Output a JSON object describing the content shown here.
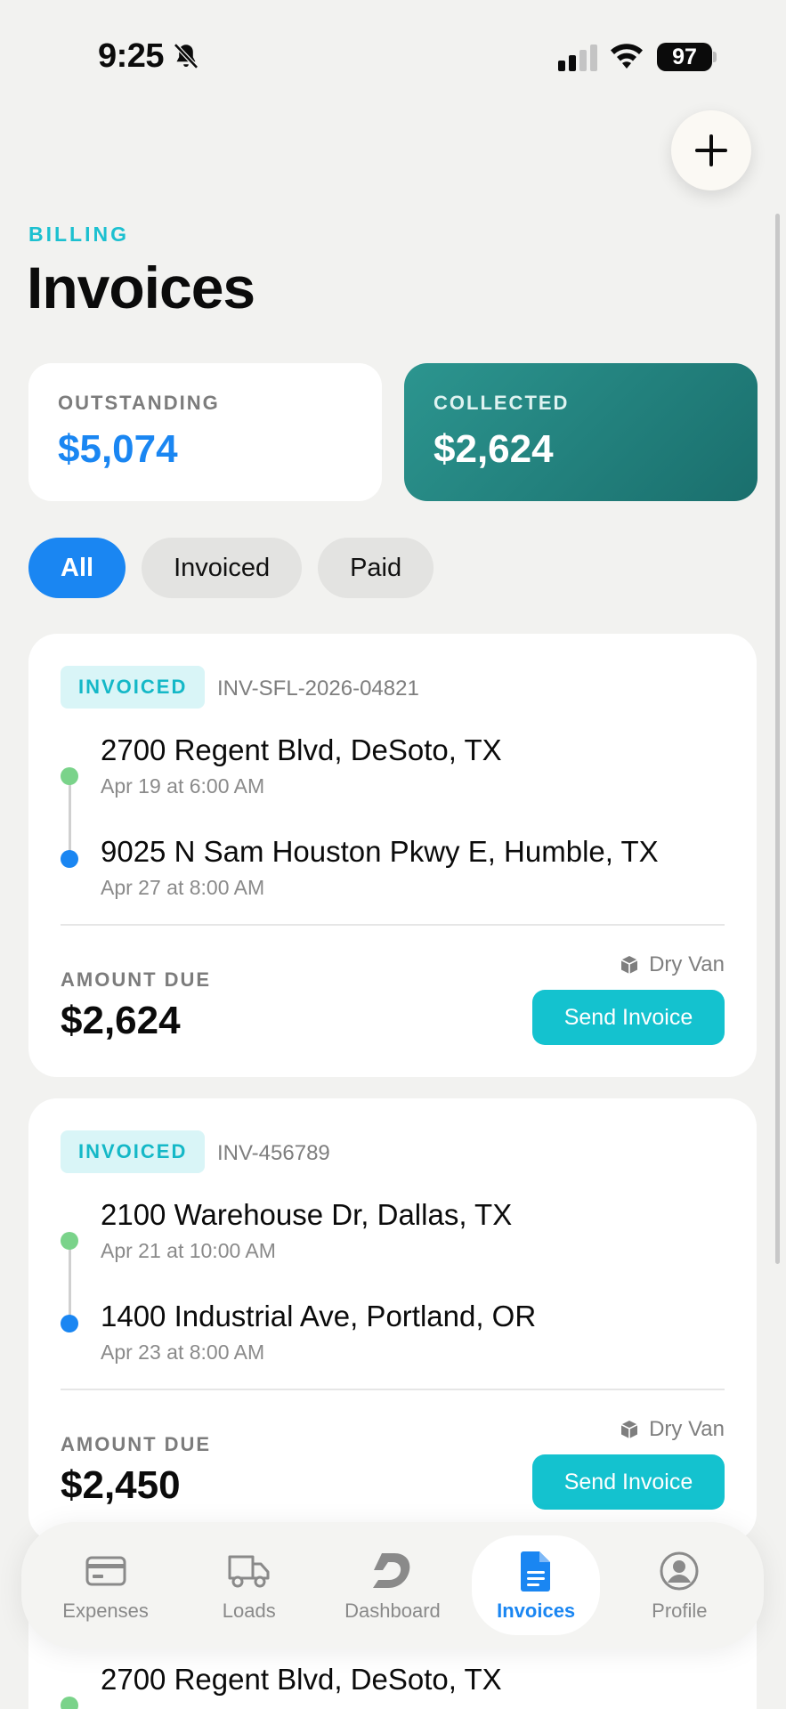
{
  "status_bar": {
    "time": "9:25",
    "battery": "97"
  },
  "header": {
    "eyebrow": "BILLING",
    "title": "Invoices"
  },
  "stats": {
    "outstanding": {
      "label": "OUTSTANDING",
      "value": "$5,074"
    },
    "collected": {
      "label": "COLLECTED",
      "value": "$2,624"
    }
  },
  "filters": [
    "All",
    "Invoiced",
    "Paid"
  ],
  "invoices": [
    {
      "status": "INVOICED",
      "id": "INV-SFL-2026-04821",
      "pickup": {
        "address": "2700 Regent Blvd, DeSoto, TX",
        "time": "Apr 19 at 6:00 AM"
      },
      "dropoff": {
        "address": "9025 N Sam Houston Pkwy E, Humble, TX",
        "time": "Apr 27 at 8:00 AM"
      },
      "amount_label": "AMOUNT DUE",
      "amount": "$2,624",
      "equipment": "Dry Van",
      "action": "Send Invoice"
    },
    {
      "status": "INVOICED",
      "id": "INV-456789",
      "pickup": {
        "address": "2100 Warehouse Dr, Dallas, TX",
        "time": "Apr 21 at 10:00 AM"
      },
      "dropoff": {
        "address": "1400 Industrial Ave, Portland, OR",
        "time": "Apr 23 at 8:00 AM"
      },
      "amount_label": "AMOUNT DUE",
      "amount": "$2,450",
      "equipment": "Dry Van",
      "action": "Send Invoice"
    },
    {
      "pickup": {
        "address": "2700 Regent Blvd, DeSoto, TX"
      }
    }
  ],
  "tabbar": [
    {
      "label": "Expenses",
      "icon": "credit-card-icon"
    },
    {
      "label": "Loads",
      "icon": "truck-icon"
    },
    {
      "label": "Dashboard",
      "icon": "dashboard-logo-icon"
    },
    {
      "label": "Invoices",
      "icon": "document-icon",
      "active": true
    },
    {
      "label": "Profile",
      "icon": "person-circle-icon"
    }
  ],
  "colors": {
    "accent": "#1a86f2",
    "teal": "#14c2cf",
    "collected_bg": "#1f7c79",
    "route_start": "#7ad38a"
  }
}
